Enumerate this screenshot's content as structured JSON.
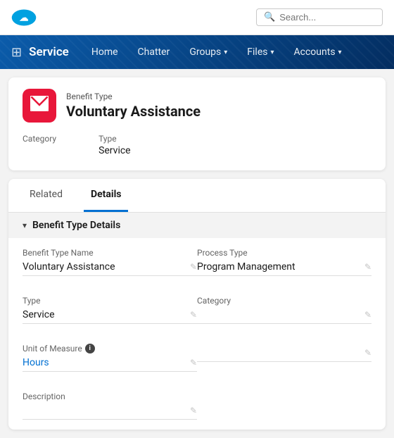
{
  "topbar": {
    "search_placeholder": "Search..."
  },
  "navbar": {
    "app_name": "Service",
    "items": [
      {
        "label": "Home",
        "has_chevron": false
      },
      {
        "label": "Chatter",
        "has_chevron": false
      },
      {
        "label": "Groups",
        "has_chevron": true
      },
      {
        "label": "Files",
        "has_chevron": true
      },
      {
        "label": "Accounts",
        "has_chevron": true
      }
    ]
  },
  "record": {
    "type_label": "Benefit Type",
    "title": "Voluntary Assistance",
    "icon_char": "✉",
    "fields": [
      {
        "label": "Category",
        "value": ""
      },
      {
        "label": "Type",
        "value": "Service"
      }
    ]
  },
  "tabs": [
    {
      "label": "Related",
      "active": false
    },
    {
      "label": "Details",
      "active": true
    }
  ],
  "section": {
    "title": "Benefit Type Details"
  },
  "detail_fields": [
    {
      "label": "Benefit Type Name",
      "value": "Voluntary Assistance",
      "has_info": false,
      "is_link": false,
      "col": 0
    },
    {
      "label": "Process Type",
      "value": "Program Management",
      "has_info": false,
      "is_link": false,
      "col": 1
    },
    {
      "label": "Type",
      "value": "Service",
      "has_info": false,
      "is_link": false,
      "col": 0
    },
    {
      "label": "Category",
      "value": "",
      "has_info": false,
      "is_link": false,
      "col": 1
    },
    {
      "label": "Unit of Measure",
      "value": "Hours",
      "has_info": true,
      "is_link": true,
      "col": 0
    },
    {
      "label": "",
      "value": "",
      "has_info": false,
      "is_link": false,
      "col": 1
    },
    {
      "label": "Description",
      "value": "",
      "has_info": false,
      "is_link": false,
      "col": 0
    }
  ],
  "icons": {
    "search": "🔍",
    "grid": "⋮⋮",
    "chevron_down": "▾",
    "chevron_right": "▸",
    "edit": "✎",
    "info": "i",
    "record": "✉"
  }
}
